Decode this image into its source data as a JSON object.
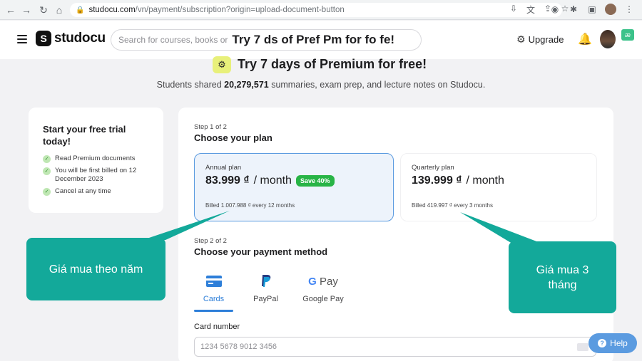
{
  "browser": {
    "url_host": "studocu.com",
    "url_path": "/vn/payment/subscription?origin=upload-document-button"
  },
  "header": {
    "logo_text": "studocu",
    "search_placeholder": "Search for courses, books or",
    "search_overlay": "Try 7 ds of Pref Pm for fo fe!",
    "upgrade_label": "Upgrade"
  },
  "hero": {
    "title": "Try 7 days of Premium for free!",
    "sub_prefix": "Students shared ",
    "sub_count": "20,279,571",
    "sub_suffix": " summaries, exam prep, and lecture notes on Studocu."
  },
  "trial": {
    "title": "Start your free trial today!",
    "items": [
      "Read Premium documents",
      "You will be first billed on 12 December 2023",
      "Cancel at any time"
    ]
  },
  "plan_step": {
    "step": "Step 1 of 2",
    "title": "Choose your plan"
  },
  "plans": [
    {
      "name": "Annual plan",
      "price": "83.999 ₫",
      "unit": "/ month",
      "badge": "Save 40%",
      "billed": "Billed 1.007.988 ₫ every 12 months",
      "selected": true
    },
    {
      "name": "Quarterly plan",
      "price": "139.999 ₫",
      "unit": "/ month",
      "billed": "Billed 419.997 ₫ every 3 months",
      "selected": false
    }
  ],
  "payment_step": {
    "step": "Step 2 of 2",
    "title": "Choose your payment method",
    "tabs": [
      "Cards",
      "PayPal",
      "Google Pay"
    ],
    "card_label": "Card number",
    "card_placeholder": "1234 5678 9012 3456"
  },
  "callouts": {
    "left": "Giá mua theo năm",
    "right": "Giá mua 3 tháng"
  },
  "help_label": "Help",
  "colors": {
    "accent": "#2e7fd9",
    "callout": "#13a99a",
    "save_badge": "#28b446"
  }
}
